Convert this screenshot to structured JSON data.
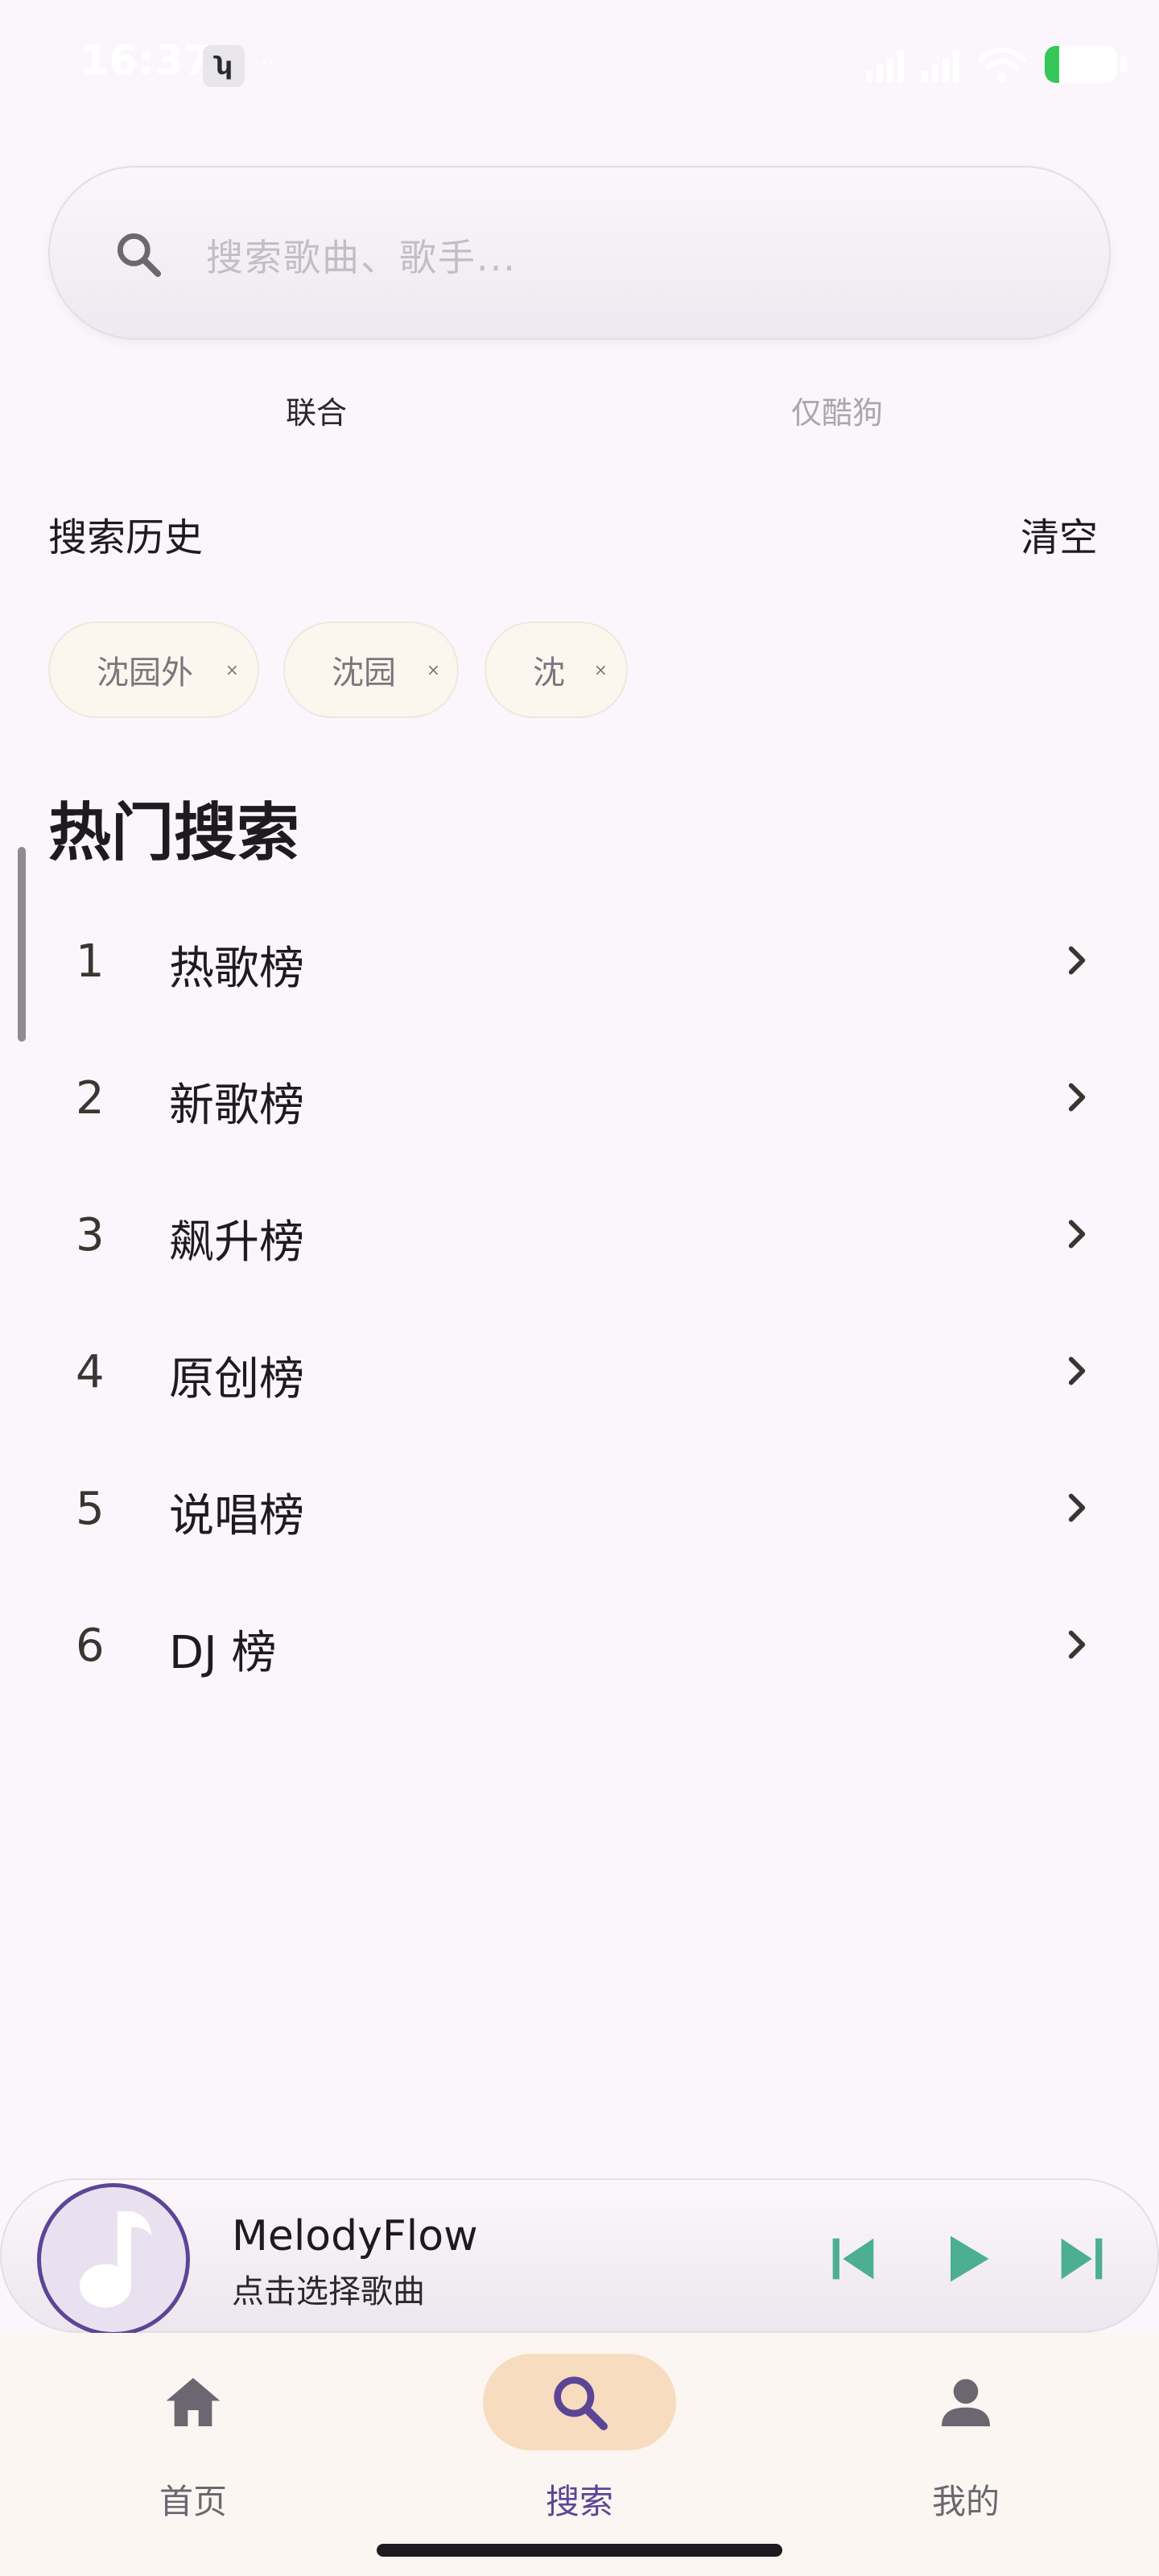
{
  "status_bar": {
    "time": "16:37",
    "app_icon": "sync-badge-icon",
    "dots": "···",
    "battery_level": 0.2
  },
  "search": {
    "placeholder": "搜索歌曲、歌手..."
  },
  "tabs": [
    {
      "label": "联合",
      "active": true
    },
    {
      "label": "仅酷狗",
      "active": false
    }
  ],
  "history": {
    "title": "搜索历史",
    "clear_label": "清空",
    "items": [
      {
        "label": "沈园外",
        "close": "×"
      },
      {
        "label": "沈园",
        "close": "×"
      },
      {
        "label": "沈",
        "close": "×"
      }
    ]
  },
  "hot": {
    "title": "热门搜索",
    "items": [
      {
        "rank": "1",
        "name": "热歌榜"
      },
      {
        "rank": "2",
        "name": "新歌榜"
      },
      {
        "rank": "3",
        "name": "飙升榜"
      },
      {
        "rank": "4",
        "name": "原创榜"
      },
      {
        "rank": "5",
        "name": "说唱榜"
      },
      {
        "rank": "6",
        "name": "DJ 榜"
      }
    ]
  },
  "player": {
    "title": "MelodyFlow",
    "subtitle": "点击选择歌曲",
    "accent_color": "#4caf8f"
  },
  "nav": {
    "items": [
      {
        "label": "首页",
        "icon": "home-icon",
        "active": false
      },
      {
        "label": "搜索",
        "icon": "search-icon",
        "active": true
      },
      {
        "label": "我的",
        "icon": "person-icon",
        "active": false
      }
    ],
    "active_color": "#5c4596"
  }
}
